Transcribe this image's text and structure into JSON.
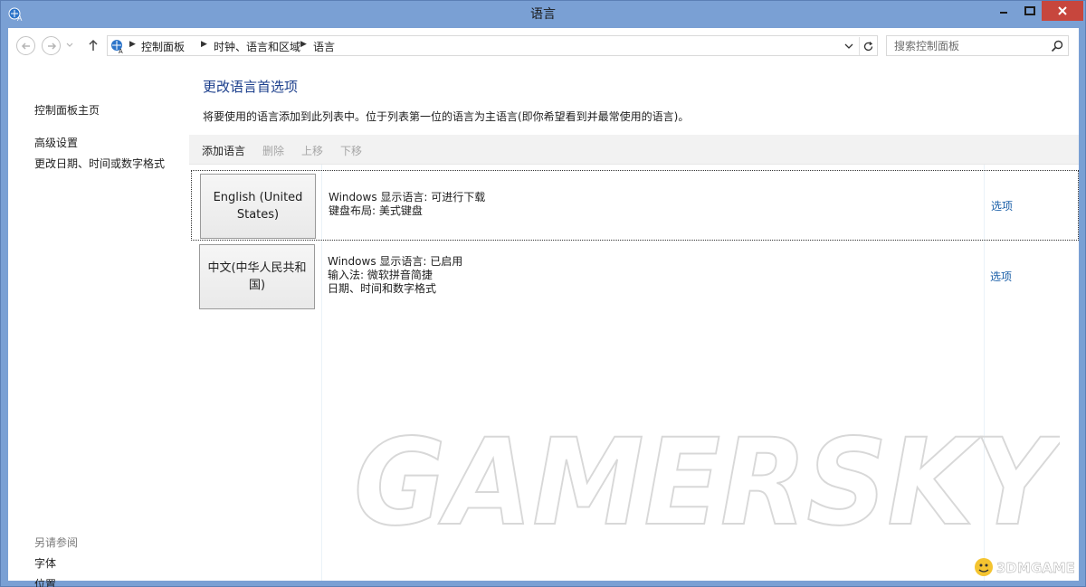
{
  "window": {
    "title": "语言"
  },
  "address": {
    "crumbs": [
      "控制面板",
      "时钟、语言和区域",
      "语言"
    ]
  },
  "search": {
    "placeholder": "搜索控制面板"
  },
  "sidebar": {
    "home": "控制面板主页",
    "links": [
      "高级设置",
      "更改日期、时间或数字格式"
    ],
    "see_also_label": "另请参阅",
    "see_also": [
      "字体",
      "位置"
    ]
  },
  "main": {
    "heading": "更改语言首选项",
    "description": "将要使用的语言添加到此列表中。位于列表第一位的语言为主语言(即你希望看到并最常使用的语言)。",
    "toolbar": {
      "add": "添加语言",
      "remove": "删除",
      "move_up": "上移",
      "move_down": "下移"
    },
    "languages": [
      {
        "name": "English (United States)",
        "details": [
          "Windows 显示语言: 可进行下载",
          "键盘布局: 美式键盘"
        ],
        "options": "选项"
      },
      {
        "name": "中文(中华人民共和国)",
        "details": [
          "Windows 显示语言: 已启用",
          "输入法: 微软拼音简捷",
          "日期、时间和数字格式"
        ],
        "options": "选项"
      }
    ]
  },
  "watermark": {
    "text": "GAMERSKY",
    "logo": "3DMGAME"
  },
  "colors": {
    "titlebar": "#7aa0d4",
    "heading": "#1c3f8c",
    "link": "#1a5fa8",
    "close": "#c7463d"
  }
}
